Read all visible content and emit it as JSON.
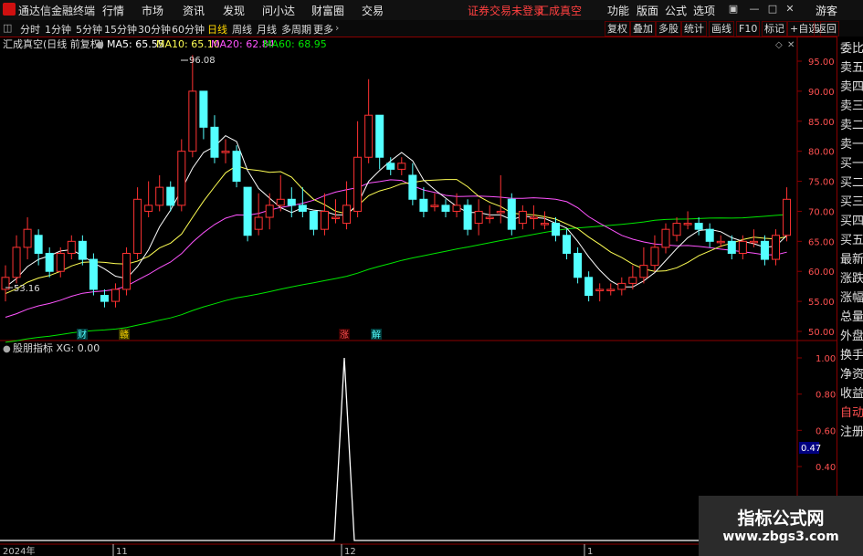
{
  "app": {
    "name": "通达信金融终端"
  },
  "menu": [
    "行情",
    "市场",
    "资讯",
    "发现",
    "问小达",
    "财富圈",
    "交易"
  ],
  "status": {
    "login": "证券交易未登录",
    "stock": "汇成真空"
  },
  "menu_right": [
    "功能",
    "版面",
    "公式",
    "选项"
  ],
  "guest": "游客",
  "periods": [
    "分时",
    "1分钟",
    "5分钟",
    "15分钟",
    "30分钟",
    "60分钟",
    "日线",
    "周线",
    "月线",
    "多周期",
    "更多"
  ],
  "active_period": "日线",
  "tools": [
    "复权",
    "叠加",
    "多股",
    "统计",
    "画线",
    "F10",
    "标记",
    "+自选",
    "返回"
  ],
  "main_chart": {
    "title": "汇成真空(日线 前复权)",
    "ma5": "MA5: 65.55",
    "ma10": "MA10: 65.10",
    "ma20": "MA20: 62.84",
    "ma60": "MA60: 68.95",
    "high_label": "96.08",
    "low_label": "53.16",
    "y_ticks": [
      "95.00",
      "90.00",
      "85.00",
      "80.00",
      "75.00",
      "70.00",
      "65.00",
      "60.00",
      "55.00",
      "50.00"
    ],
    "markers": [
      "财",
      "赣",
      "涨",
      "解"
    ],
    "colors": {
      "up": "#ff3232",
      "down": "#54ffff",
      "ma5": "#ffffff",
      "ma10": "#ffff54",
      "ma20": "#ff54ff",
      "ma60": "#00e600"
    }
  },
  "indicator": {
    "title": "股朋指标 XG: 0.00",
    "y_ticks": [
      "1.00",
      "0.80",
      "0.60",
      "0.40"
    ],
    "current": "0.47"
  },
  "x_axis": [
    "2024年",
    "11",
    "12",
    "1"
  ],
  "right_panel": [
    "委比",
    "卖五",
    "卖四",
    "卖三",
    "卖二",
    "卖一",
    "买一",
    "买二",
    "买三",
    "买四",
    "买五",
    "最新",
    "涨跌",
    "涨幅",
    "总量",
    "外盘",
    "换手",
    "净资",
    "收益",
    "自动",
    "注册"
  ],
  "watermark": {
    "line1": "指标公式网",
    "line2": "www.zbgs3.com"
  }
}
